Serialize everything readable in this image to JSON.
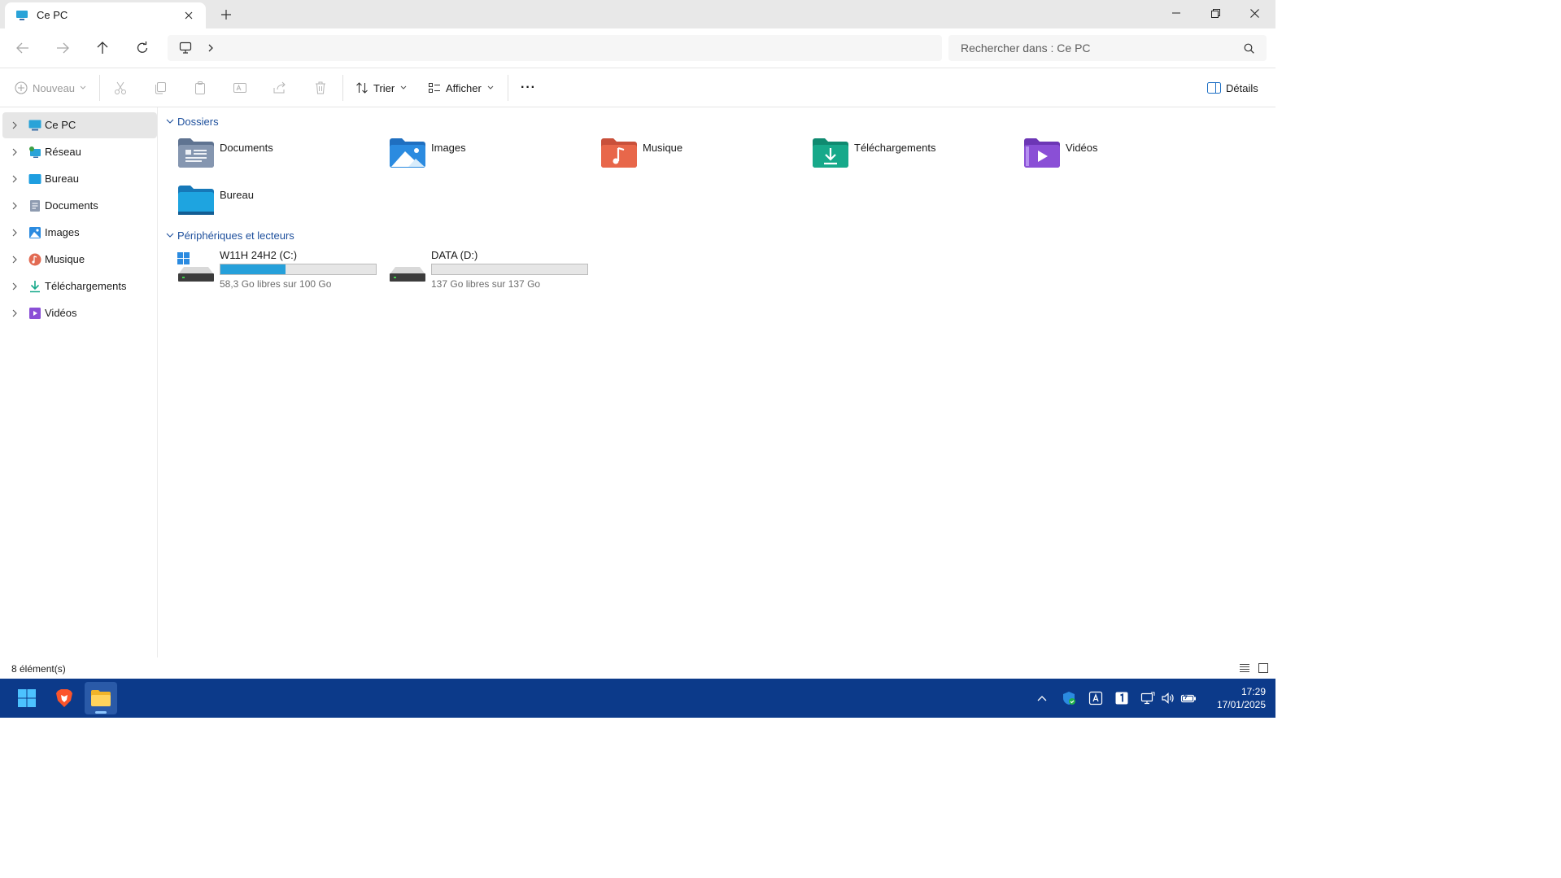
{
  "window": {
    "tab_title": "Ce PC",
    "tab_icon": "computer-icon",
    "new_tab_label": "+"
  },
  "address": {
    "location_icon": "computer-icon",
    "search_placeholder": "Rechercher dans : Ce PC"
  },
  "commands": {
    "new_label": "Nouveau",
    "sort_label": "Trier",
    "view_label": "Afficher",
    "more_label": "···",
    "details_label": "Détails"
  },
  "sidebar": {
    "items": [
      {
        "label": "Ce PC",
        "icon": "computer-icon",
        "selected": true
      },
      {
        "label": "Réseau",
        "icon": "network-icon"
      },
      {
        "label": "Bureau",
        "icon": "desktop-icon"
      },
      {
        "label": "Documents",
        "icon": "documents-icon"
      },
      {
        "label": "Images",
        "icon": "pictures-icon"
      },
      {
        "label": "Musique",
        "icon": "music-icon"
      },
      {
        "label": "Téléchargements",
        "icon": "downloads-icon"
      },
      {
        "label": "Vidéos",
        "icon": "videos-icon"
      }
    ]
  },
  "content": {
    "folders_heading": "Dossiers",
    "folders": [
      {
        "label": "Documents",
        "icon": "documents-folder-icon",
        "color": "#6b7f9c"
      },
      {
        "label": "Images",
        "icon": "pictures-folder-icon",
        "color": "#2b8be0"
      },
      {
        "label": "Musique",
        "icon": "music-folder-icon",
        "color": "#e8674a"
      },
      {
        "label": "Téléchargements",
        "icon": "downloads-folder-icon",
        "color": "#17a98a"
      },
      {
        "label": "Vidéos",
        "icon": "videos-folder-icon",
        "color": "#8a4fd6"
      },
      {
        "label": "Bureau",
        "icon": "desktop-folder-icon",
        "color": "#1ea4e0"
      }
    ],
    "drives_heading": "Périphériques et lecteurs",
    "drives": [
      {
        "name": "W11H 24H2 (C:)",
        "free_text": "58,3 Go libres sur 100 Go",
        "used_fraction": 0.417,
        "icon": "windows-drive-icon"
      },
      {
        "name": "DATA (D:)",
        "free_text": "137 Go libres sur 137 Go",
        "used_fraction": 0.0,
        "icon": "hard-drive-icon"
      }
    ]
  },
  "status": {
    "count_text": "8 élément(s)"
  },
  "taskbar": {
    "time": "17:29",
    "date": "17/01/2025",
    "accent": "#0c3a8a"
  }
}
